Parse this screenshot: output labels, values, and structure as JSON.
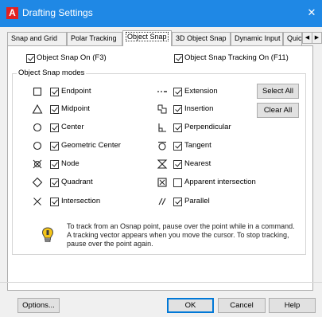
{
  "window": {
    "app_icon_letter": "A",
    "title": "Drafting Settings",
    "close_glyph": "✕"
  },
  "tabs": [
    {
      "label": "Snap and Grid",
      "active": false
    },
    {
      "label": "Polar Tracking",
      "active": false
    },
    {
      "label": "Object Snap",
      "active": true
    },
    {
      "label": "3D Object Snap",
      "active": false
    },
    {
      "label": "Dynamic Input",
      "active": false
    },
    {
      "label": "Quic",
      "active": false
    }
  ],
  "tab_scroll": {
    "left": "◀",
    "right": "▶"
  },
  "options": {
    "osnap_on": {
      "label": "Object Snap On (F3)",
      "checked": true
    },
    "tracking_on": {
      "label": "Object Snap Tracking On (F11)",
      "checked": true
    }
  },
  "modes_group": {
    "title": "Object Snap modes",
    "left": [
      {
        "symbol": "square-icon",
        "label": "Endpoint",
        "checked": true
      },
      {
        "symbol": "triangle-icon",
        "label": "Midpoint",
        "checked": true
      },
      {
        "symbol": "circle-icon",
        "label": "Center",
        "checked": true
      },
      {
        "symbol": "circle-icon",
        "label": "Geometric Center",
        "checked": true
      },
      {
        "symbol": "node-icon",
        "label": "Node",
        "checked": true
      },
      {
        "symbol": "diamond-icon",
        "label": "Quadrant",
        "checked": true
      },
      {
        "symbol": "x-icon",
        "label": "Intersection",
        "checked": true
      }
    ],
    "right": [
      {
        "symbol": "extension-icon",
        "label": "Extension",
        "checked": true
      },
      {
        "symbol": "insertion-icon",
        "label": "Insertion",
        "checked": true
      },
      {
        "symbol": "perpendicular-icon",
        "label": "Perpendicular",
        "checked": true
      },
      {
        "symbol": "tangent-icon",
        "label": "Tangent",
        "checked": true
      },
      {
        "symbol": "nearest-icon",
        "label": "Nearest",
        "checked": true
      },
      {
        "symbol": "apparent-intersection-icon",
        "label": "Apparent intersection",
        "checked": false
      },
      {
        "symbol": "parallel-icon",
        "label": "Parallel",
        "checked": true
      }
    ],
    "select_all_label": "Select All",
    "clear_all_label": "Clear All",
    "info_icon": "lightbulb-icon",
    "info_text": "To track from an Osnap point, pause over the point while in a command.  A tracking vector appears when you move the cursor.  To stop tracking, pause over the point again."
  },
  "footer": {
    "options_label": "Options...",
    "ok_label": "OK",
    "cancel_label": "Cancel",
    "help_label": "Help"
  },
  "colors": {
    "titlebar": "#1f88e5",
    "app_icon": "#e32121",
    "default_button_border": "#0078d7"
  }
}
